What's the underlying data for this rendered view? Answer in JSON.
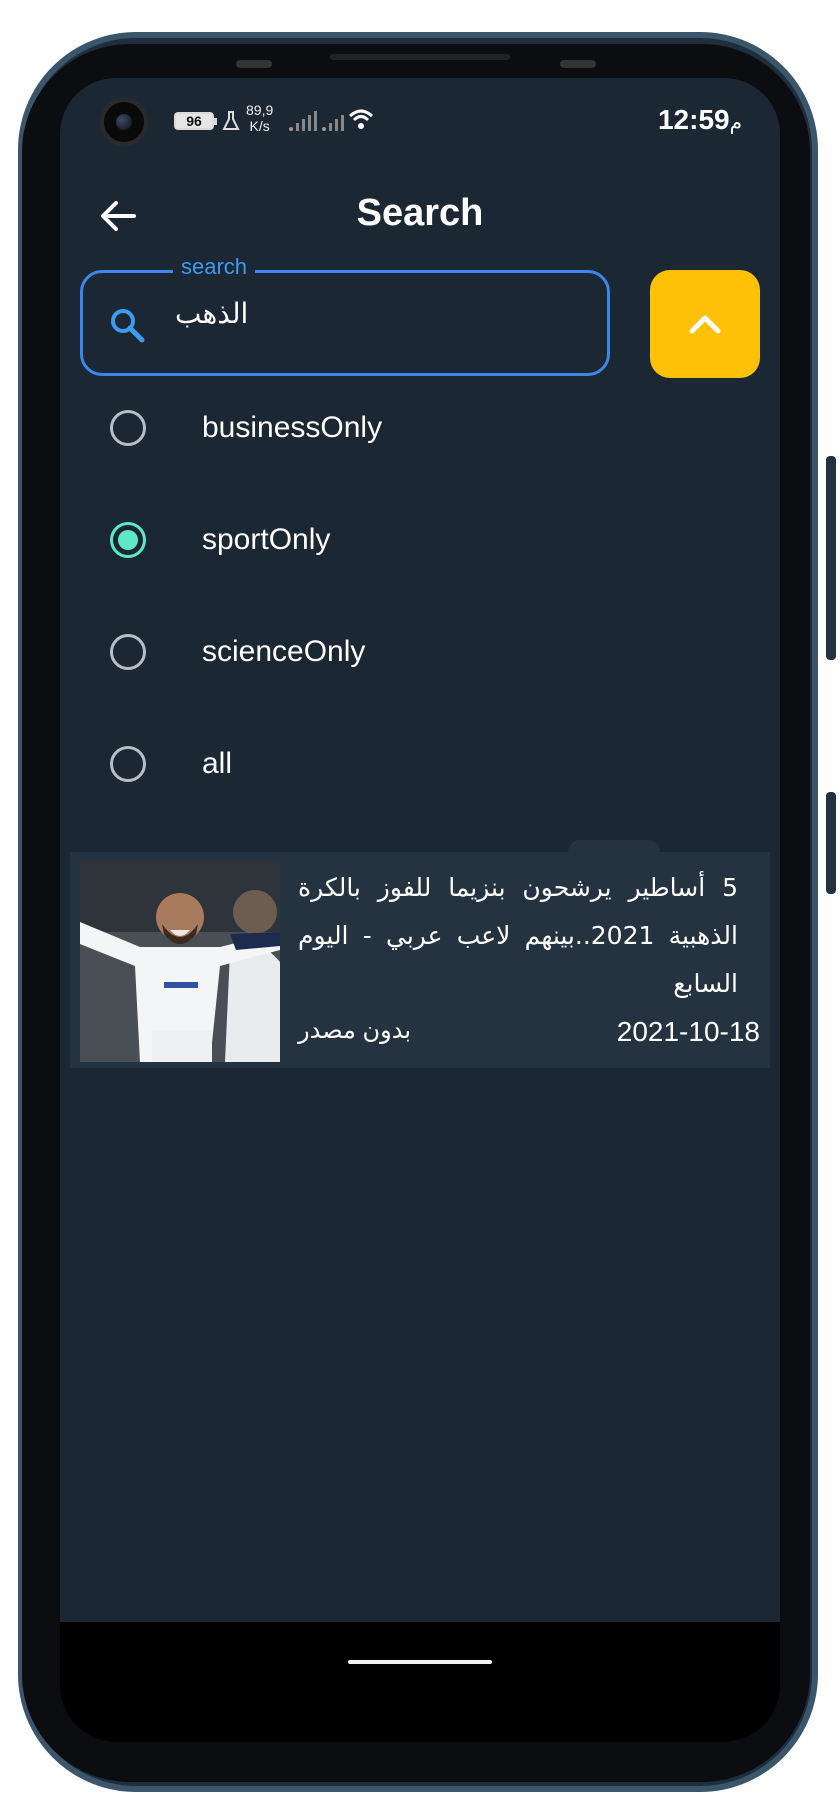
{
  "status_bar": {
    "battery": "96",
    "net_speed_value": "89,9",
    "net_speed_unit": "K/s",
    "time": "12:59",
    "ampm": "م"
  },
  "app_bar": {
    "title": "Search"
  },
  "search": {
    "label": "search",
    "value": "الذهب"
  },
  "filters": [
    {
      "label": "businessOnly",
      "checked": false
    },
    {
      "label": "sportOnly",
      "checked": true
    },
    {
      "label": "scienceOnly",
      "checked": false
    },
    {
      "label": "all",
      "checked": false
    }
  ],
  "results": [
    {
      "title": "5 أساطير يرشحون بنزيما للفوز بالكرة الذهبية 2021..بينهم لاعب عربي - اليوم السابع",
      "source": "بدون مصدر",
      "date": "2021-10-18"
    }
  ],
  "colors": {
    "background": "#1c2734",
    "card": "#253341",
    "accent_blue": "#3d86ea",
    "accent_yellow": "#ffc107",
    "radio_checked": "#5ee8c6"
  }
}
